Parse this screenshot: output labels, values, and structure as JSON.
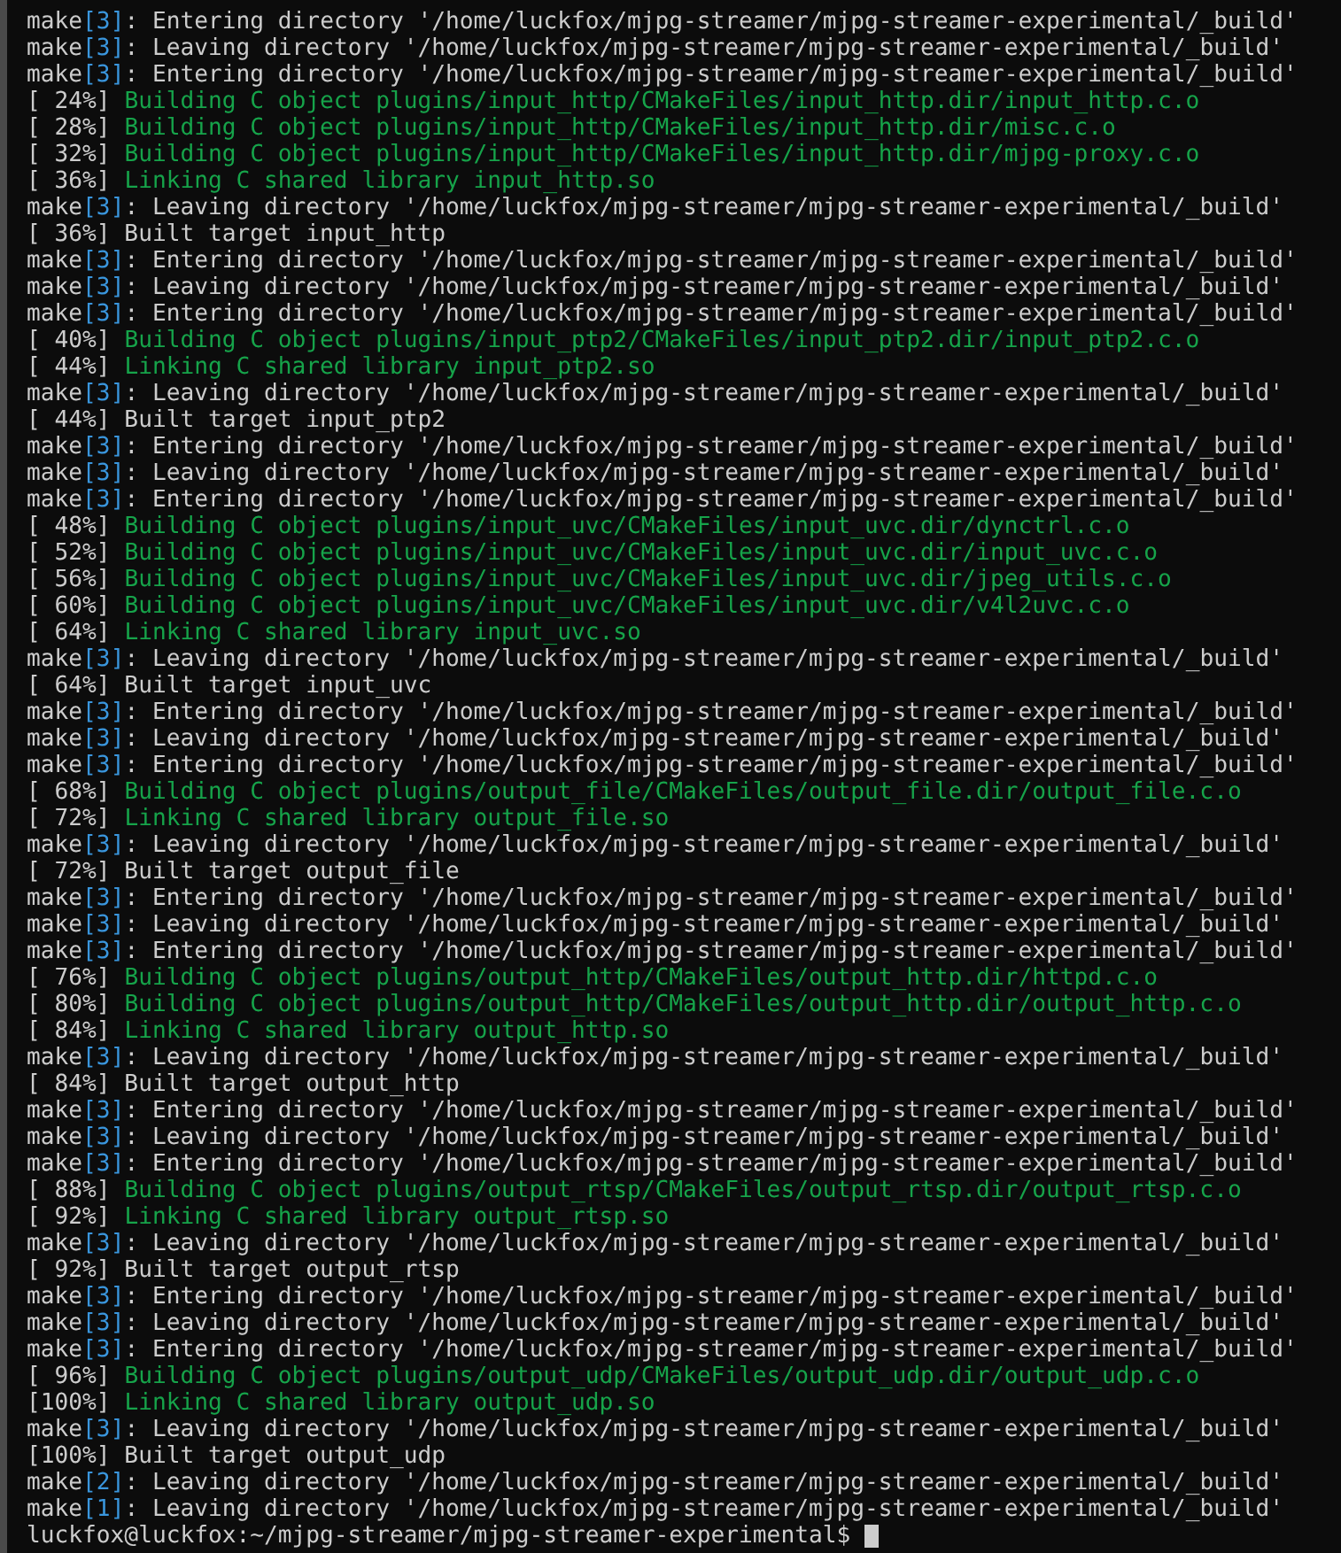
{
  "terminal": {
    "lines": [
      {
        "kind": "make",
        "command": "make",
        "level": "[3]",
        "text": ": Entering directory '/home/luckfox/mjpg-streamer/mjpg-streamer-experimental/_build'"
      },
      {
        "kind": "make",
        "command": "make",
        "level": "[3]",
        "text": ": Leaving directory '/home/luckfox/mjpg-streamer/mjpg-streamer-experimental/_build'"
      },
      {
        "kind": "make",
        "command": "make",
        "level": "[3]",
        "text": ": Entering directory '/home/luckfox/mjpg-streamer/mjpg-streamer-experimental/_build'"
      },
      {
        "kind": "step",
        "percent": "[ 24%]",
        "text": "Building C object plugins/input_http/CMakeFiles/input_http.dir/input_http.c.o"
      },
      {
        "kind": "step",
        "percent": "[ 28%]",
        "text": "Building C object plugins/input_http/CMakeFiles/input_http.dir/misc.c.o"
      },
      {
        "kind": "step",
        "percent": "[ 32%]",
        "text": "Building C object plugins/input_http/CMakeFiles/input_http.dir/mjpg-proxy.c.o"
      },
      {
        "kind": "step",
        "percent": "[ 36%]",
        "text": "Linking C shared library input_http.so"
      },
      {
        "kind": "make",
        "command": "make",
        "level": "[3]",
        "text": ": Leaving directory '/home/luckfox/mjpg-streamer/mjpg-streamer-experimental/_build'"
      },
      {
        "kind": "target",
        "percent": "[ 36%]",
        "text": "Built target input_http"
      },
      {
        "kind": "make",
        "command": "make",
        "level": "[3]",
        "text": ": Entering directory '/home/luckfox/mjpg-streamer/mjpg-streamer-experimental/_build'"
      },
      {
        "kind": "make",
        "command": "make",
        "level": "[3]",
        "text": ": Leaving directory '/home/luckfox/mjpg-streamer/mjpg-streamer-experimental/_build'"
      },
      {
        "kind": "make",
        "command": "make",
        "level": "[3]",
        "text": ": Entering directory '/home/luckfox/mjpg-streamer/mjpg-streamer-experimental/_build'"
      },
      {
        "kind": "step",
        "percent": "[ 40%]",
        "text": "Building C object plugins/input_ptp2/CMakeFiles/input_ptp2.dir/input_ptp2.c.o"
      },
      {
        "kind": "step",
        "percent": "[ 44%]",
        "text": "Linking C shared library input_ptp2.so"
      },
      {
        "kind": "make",
        "command": "make",
        "level": "[3]",
        "text": ": Leaving directory '/home/luckfox/mjpg-streamer/mjpg-streamer-experimental/_build'"
      },
      {
        "kind": "target",
        "percent": "[ 44%]",
        "text": "Built target input_ptp2"
      },
      {
        "kind": "make",
        "command": "make",
        "level": "[3]",
        "text": ": Entering directory '/home/luckfox/mjpg-streamer/mjpg-streamer-experimental/_build'"
      },
      {
        "kind": "make",
        "command": "make",
        "level": "[3]",
        "text": ": Leaving directory '/home/luckfox/mjpg-streamer/mjpg-streamer-experimental/_build'"
      },
      {
        "kind": "make",
        "command": "make",
        "level": "[3]",
        "text": ": Entering directory '/home/luckfox/mjpg-streamer/mjpg-streamer-experimental/_build'"
      },
      {
        "kind": "step",
        "percent": "[ 48%]",
        "text": "Building C object plugins/input_uvc/CMakeFiles/input_uvc.dir/dynctrl.c.o"
      },
      {
        "kind": "step",
        "percent": "[ 52%]",
        "text": "Building C object plugins/input_uvc/CMakeFiles/input_uvc.dir/input_uvc.c.o"
      },
      {
        "kind": "step",
        "percent": "[ 56%]",
        "text": "Building C object plugins/input_uvc/CMakeFiles/input_uvc.dir/jpeg_utils.c.o"
      },
      {
        "kind": "step",
        "percent": "[ 60%]",
        "text": "Building C object plugins/input_uvc/CMakeFiles/input_uvc.dir/v4l2uvc.c.o"
      },
      {
        "kind": "step",
        "percent": "[ 64%]",
        "text": "Linking C shared library input_uvc.so"
      },
      {
        "kind": "make",
        "command": "make",
        "level": "[3]",
        "text": ": Leaving directory '/home/luckfox/mjpg-streamer/mjpg-streamer-experimental/_build'"
      },
      {
        "kind": "target",
        "percent": "[ 64%]",
        "text": "Built target input_uvc"
      },
      {
        "kind": "make",
        "command": "make",
        "level": "[3]",
        "text": ": Entering directory '/home/luckfox/mjpg-streamer/mjpg-streamer-experimental/_build'"
      },
      {
        "kind": "make",
        "command": "make",
        "level": "[3]",
        "text": ": Leaving directory '/home/luckfox/mjpg-streamer/mjpg-streamer-experimental/_build'"
      },
      {
        "kind": "make",
        "command": "make",
        "level": "[3]",
        "text": ": Entering directory '/home/luckfox/mjpg-streamer/mjpg-streamer-experimental/_build'"
      },
      {
        "kind": "step",
        "percent": "[ 68%]",
        "text": "Building C object plugins/output_file/CMakeFiles/output_file.dir/output_file.c.o"
      },
      {
        "kind": "step",
        "percent": "[ 72%]",
        "text": "Linking C shared library output_file.so"
      },
      {
        "kind": "make",
        "command": "make",
        "level": "[3]",
        "text": ": Leaving directory '/home/luckfox/mjpg-streamer/mjpg-streamer-experimental/_build'"
      },
      {
        "kind": "target",
        "percent": "[ 72%]",
        "text": "Built target output_file"
      },
      {
        "kind": "make",
        "command": "make",
        "level": "[3]",
        "text": ": Entering directory '/home/luckfox/mjpg-streamer/mjpg-streamer-experimental/_build'"
      },
      {
        "kind": "make",
        "command": "make",
        "level": "[3]",
        "text": ": Leaving directory '/home/luckfox/mjpg-streamer/mjpg-streamer-experimental/_build'"
      },
      {
        "kind": "make",
        "command": "make",
        "level": "[3]",
        "text": ": Entering directory '/home/luckfox/mjpg-streamer/mjpg-streamer-experimental/_build'"
      },
      {
        "kind": "step",
        "percent": "[ 76%]",
        "text": "Building C object plugins/output_http/CMakeFiles/output_http.dir/httpd.c.o"
      },
      {
        "kind": "step",
        "percent": "[ 80%]",
        "text": "Building C object plugins/output_http/CMakeFiles/output_http.dir/output_http.c.o"
      },
      {
        "kind": "step",
        "percent": "[ 84%]",
        "text": "Linking C shared library output_http.so"
      },
      {
        "kind": "make",
        "command": "make",
        "level": "[3]",
        "text": ": Leaving directory '/home/luckfox/mjpg-streamer/mjpg-streamer-experimental/_build'"
      },
      {
        "kind": "target",
        "percent": "[ 84%]",
        "text": "Built target output_http"
      },
      {
        "kind": "make",
        "command": "make",
        "level": "[3]",
        "text": ": Entering directory '/home/luckfox/mjpg-streamer/mjpg-streamer-experimental/_build'"
      },
      {
        "kind": "make",
        "command": "make",
        "level": "[3]",
        "text": ": Leaving directory '/home/luckfox/mjpg-streamer/mjpg-streamer-experimental/_build'"
      },
      {
        "kind": "make",
        "command": "make",
        "level": "[3]",
        "text": ": Entering directory '/home/luckfox/mjpg-streamer/mjpg-streamer-experimental/_build'"
      },
      {
        "kind": "step",
        "percent": "[ 88%]",
        "text": "Building C object plugins/output_rtsp/CMakeFiles/output_rtsp.dir/output_rtsp.c.o"
      },
      {
        "kind": "step",
        "percent": "[ 92%]",
        "text": "Linking C shared library output_rtsp.so"
      },
      {
        "kind": "make",
        "command": "make",
        "level": "[3]",
        "text": ": Leaving directory '/home/luckfox/mjpg-streamer/mjpg-streamer-experimental/_build'"
      },
      {
        "kind": "target",
        "percent": "[ 92%]",
        "text": "Built target output_rtsp"
      },
      {
        "kind": "make",
        "command": "make",
        "level": "[3]",
        "text": ": Entering directory '/home/luckfox/mjpg-streamer/mjpg-streamer-experimental/_build'"
      },
      {
        "kind": "make",
        "command": "make",
        "level": "[3]",
        "text": ": Leaving directory '/home/luckfox/mjpg-streamer/mjpg-streamer-experimental/_build'"
      },
      {
        "kind": "make",
        "command": "make",
        "level": "[3]",
        "text": ": Entering directory '/home/luckfox/mjpg-streamer/mjpg-streamer-experimental/_build'"
      },
      {
        "kind": "step",
        "percent": "[ 96%]",
        "text": "Building C object plugins/output_udp/CMakeFiles/output_udp.dir/output_udp.c.o"
      },
      {
        "kind": "step",
        "percent": "[100%]",
        "text": "Linking C shared library output_udp.so"
      },
      {
        "kind": "make",
        "command": "make",
        "level": "[3]",
        "text": ": Leaving directory '/home/luckfox/mjpg-streamer/mjpg-streamer-experimental/_build'"
      },
      {
        "kind": "target",
        "percent": "[100%]",
        "text": "Built target output_udp"
      },
      {
        "kind": "make",
        "command": "make",
        "level": "[2]",
        "text": ": Leaving directory '/home/luckfox/mjpg-streamer/mjpg-streamer-experimental/_build'"
      },
      {
        "kind": "make",
        "command": "make",
        "level": "[1]",
        "text": ": Leaving directory '/home/luckfox/mjpg-streamer/mjpg-streamer-experimental/_build'"
      }
    ],
    "prompt": "luckfox@luckfox:~/mjpg-streamer/mjpg-streamer-experimental$"
  }
}
